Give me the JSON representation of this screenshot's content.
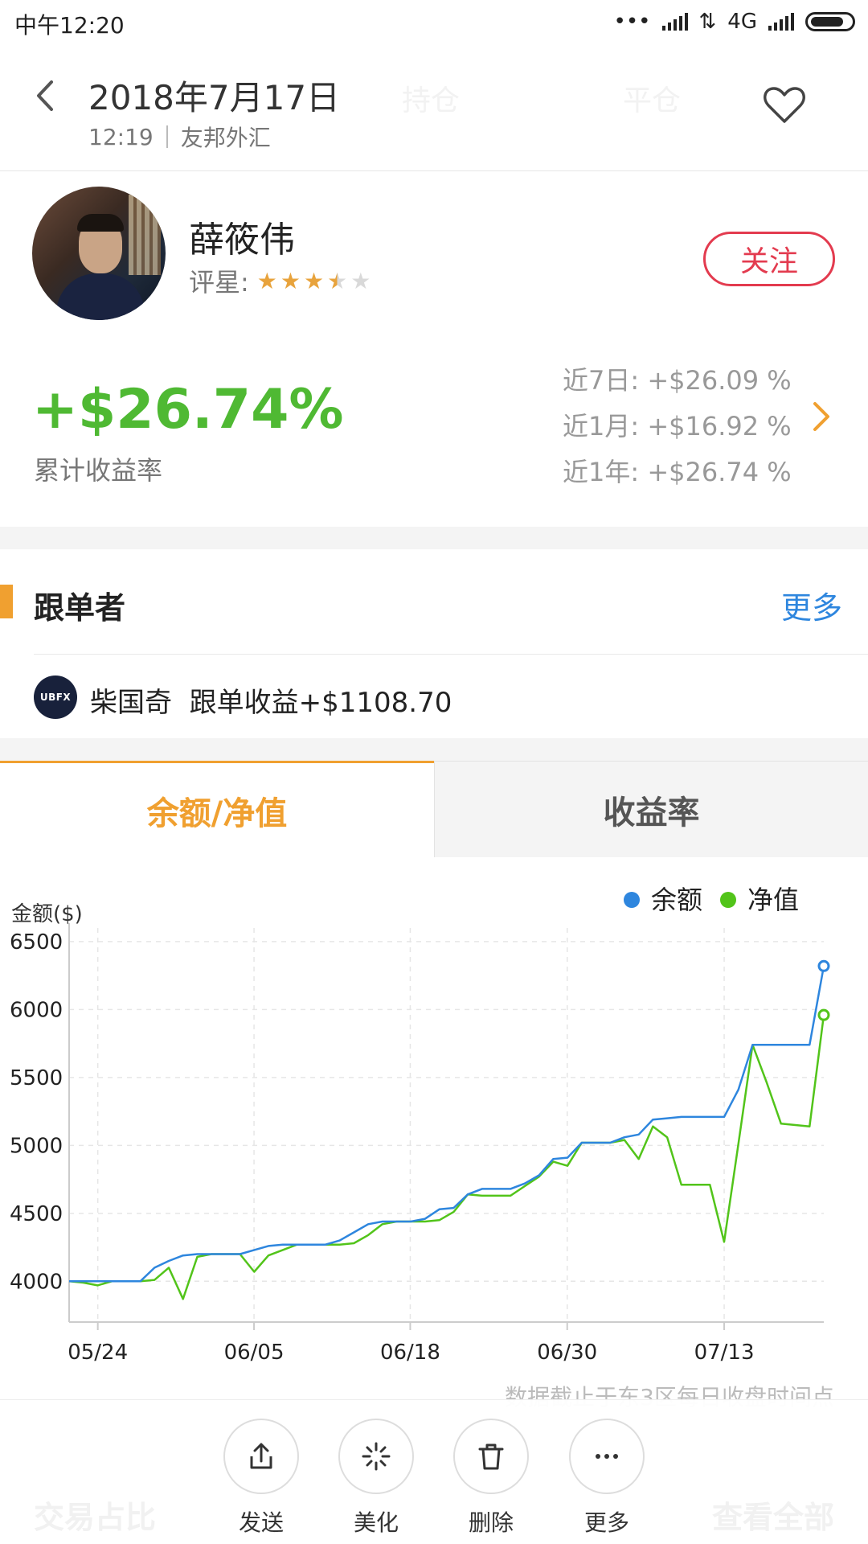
{
  "status": {
    "time": "中午12:20",
    "network": "4G"
  },
  "header": {
    "title": "2018年7月17日",
    "time": "12:19",
    "source": "友邦外汇",
    "ghost_tab1": "持仓",
    "ghost_tab2": "平仓"
  },
  "profile": {
    "name": "薛筱伟",
    "rating_label": "评星:",
    "rating_value": 3.5,
    "follow_label": "关注"
  },
  "returns": {
    "total": "+$26.74%",
    "total_label": "累计收益率",
    "periods": [
      {
        "label": "近7日: +$26.09 %"
      },
      {
        "label": "近1月: +$16.92 %"
      },
      {
        "label": "近1年: +$26.74 %"
      }
    ]
  },
  "followers": {
    "title": "跟单者",
    "more": "更多",
    "items": [
      {
        "icon_text": "UBFX",
        "name": "柴国奇",
        "profit": "跟单收益+$1108.70"
      }
    ]
  },
  "tabs": [
    {
      "label": "余额/净值",
      "active": true
    },
    {
      "label": "收益率",
      "active": false
    }
  ],
  "chart_data": {
    "type": "line",
    "ylabel": "金额($)",
    "yticks": [
      4000,
      4500,
      5000,
      5500,
      6000,
      6500
    ],
    "ylim": [
      3700,
      6600
    ],
    "xticks": [
      "05/24",
      "06/05",
      "06/18",
      "06/30",
      "07/13"
    ],
    "legend_position": "top-right",
    "grid": true,
    "series": [
      {
        "name": "余额",
        "color": "#2e86de",
        "values": [
          4000,
          4000,
          4000,
          4000,
          4000,
          4000,
          4100,
          4150,
          4190,
          4200,
          4200,
          4200,
          4200,
          4230,
          4260,
          4270,
          4270,
          4270,
          4270,
          4300,
          4360,
          4420,
          4440,
          4440,
          4440,
          4460,
          4530,
          4540,
          4640,
          4680,
          4680,
          4680,
          4720,
          4780,
          4900,
          4910,
          5020,
          5020,
          5020,
          5060,
          5080,
          5190,
          5200,
          5210,
          5210,
          5210,
          5210,
          5410,
          5740,
          5740,
          5740,
          5740,
          5740,
          6320
        ]
      },
      {
        "name": "净值",
        "color": "#52c41a",
        "values": [
          4000,
          3990,
          3970,
          4000,
          4000,
          4000,
          4010,
          4100,
          3870,
          4180,
          4200,
          4200,
          4200,
          4070,
          4190,
          4230,
          4270,
          4270,
          4270,
          4270,
          4280,
          4340,
          4420,
          4440,
          4440,
          4440,
          4450,
          4510,
          4640,
          4630,
          4630,
          4630,
          4700,
          4770,
          4880,
          4850,
          5020,
          5020,
          5020,
          5040,
          4900,
          5140,
          5060,
          4710,
          4710,
          4710,
          4290,
          5010,
          5740,
          5460,
          5160,
          5150,
          5140,
          5960
        ]
      }
    ]
  },
  "footnote": "数据截止于东3区每日收盘时间点",
  "sheet": {
    "underlay_left": "交易占比",
    "underlay_right": "查看全部",
    "actions": [
      {
        "label": "发送"
      },
      {
        "label": "美化"
      },
      {
        "label": "删除"
      },
      {
        "label": "更多"
      }
    ]
  }
}
